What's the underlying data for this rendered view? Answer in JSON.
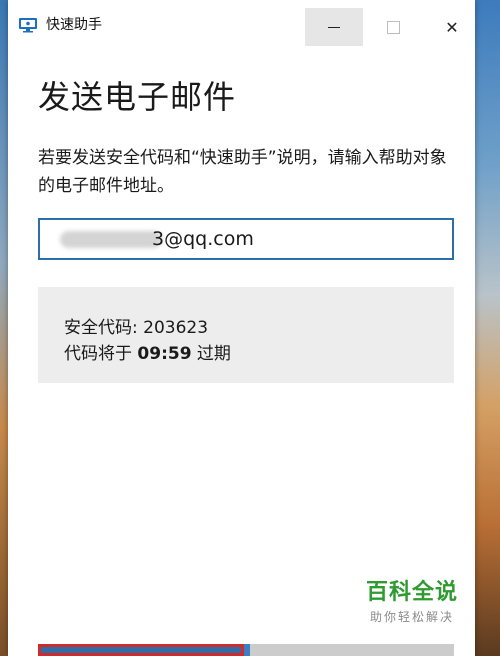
{
  "window": {
    "title": "快速助手",
    "min_label": "",
    "max_label": "",
    "close_label": "✕"
  },
  "page": {
    "heading": "发送电子邮件",
    "instructions": "若要发送安全代码和“快速助手”说明，请输入帮助对象的电子邮件地址。"
  },
  "email": {
    "visible_value": "3@qq.com"
  },
  "info": {
    "security_code_label": "安全代码: 203623",
    "expiry_prefix": "代码将于 ",
    "expiry_time": "09:59",
    "expiry_suffix": " 过期"
  },
  "watermark": {
    "main": "百科全说",
    "sub": "助你轻松解决"
  },
  "colors": {
    "accent": "#2d6ea8",
    "highlight": "#d12a2a",
    "watermark_green": "#2f9a2f"
  }
}
